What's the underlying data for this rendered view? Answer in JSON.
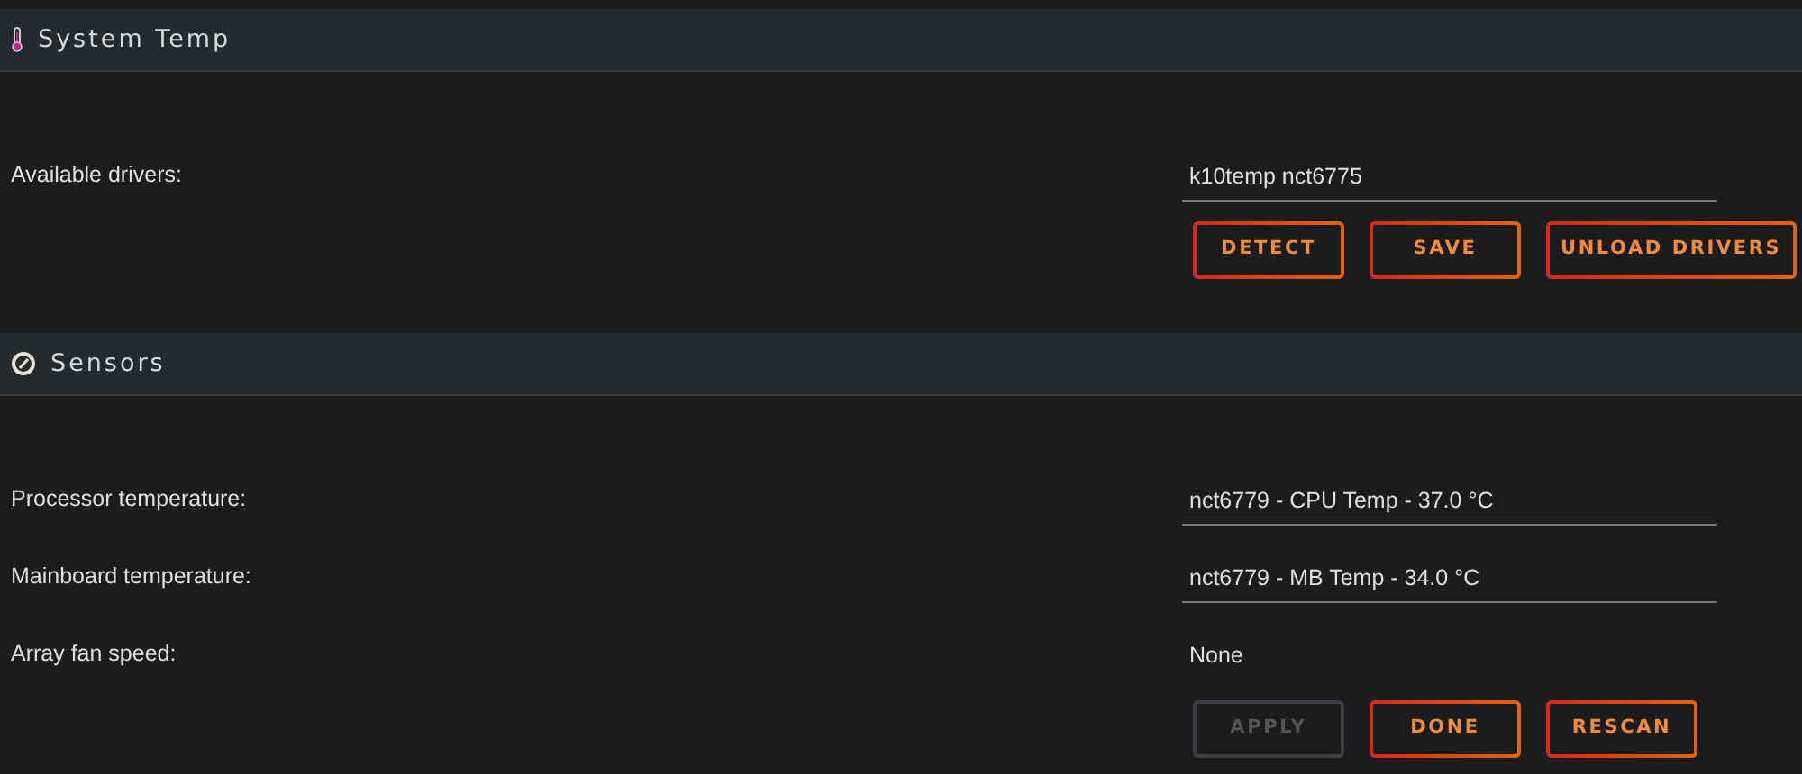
{
  "sections": [
    {
      "title": "System Temp",
      "fields": [
        {
          "label": "Available drivers:",
          "value": "k10temp nct6775",
          "underline": true
        }
      ],
      "buttons": [
        {
          "label": "DETECT",
          "disabled": false
        },
        {
          "label": "SAVE",
          "disabled": false
        },
        {
          "label": "UNLOAD DRIVERS",
          "disabled": false
        }
      ]
    },
    {
      "title": "Sensors",
      "fields": [
        {
          "label": "Processor temperature:",
          "value": "nct6779 - CPU Temp - 37.0 °C",
          "underline": true
        },
        {
          "label": "Mainboard temperature:",
          "value": "nct6779 - MB Temp - 34.0 °C",
          "underline": true
        },
        {
          "label": "Array fan speed:",
          "value": "None",
          "underline": false
        }
      ],
      "buttons": [
        {
          "label": "APPLY",
          "disabled": true
        },
        {
          "label": "DONE",
          "disabled": false
        },
        {
          "label": "RESCAN",
          "disabled": false
        }
      ]
    }
  ]
}
